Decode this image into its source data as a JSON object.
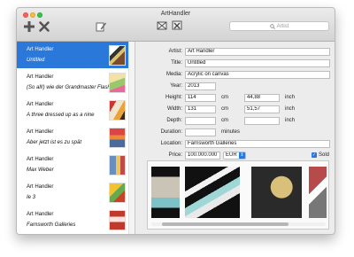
{
  "window": {
    "title": "ArtHandler"
  },
  "toolbar": {
    "search_placeholder": "Artist"
  },
  "list": [
    {
      "artist": "Art Handler",
      "title": "Untitled"
    },
    {
      "artist": "Art Handler",
      "title": "(So all!) wie der Grandmaster Flash"
    },
    {
      "artist": "Art Handler",
      "title": "A three dressed up as a nine"
    },
    {
      "artist": "Art Handler",
      "title": "Aber jetzt ist es zu spät"
    },
    {
      "artist": "Art Handler",
      "title": "Max Weber"
    },
    {
      "artist": "Art Handler",
      "title": "Ie 3"
    },
    {
      "artist": "Art Handler",
      "title": "Farnsworth Galleries"
    }
  ],
  "form": {
    "artist_label": "Artist:",
    "artist_value": "Art Handler",
    "title_label": "Title:",
    "title_value": "Untitled",
    "media_label": "Media:",
    "media_value": "Acrylic on canvas",
    "year_label": "Year:",
    "year_value": "2013",
    "height_label": "Height:",
    "height_cm": "114",
    "height_inch": "44,88",
    "width_label": "Width:",
    "width_cm": "131",
    "width_inch": "51,57",
    "depth_label": "Depth:",
    "depth_cm": "",
    "depth_inch": "",
    "unit_cm": "cm",
    "unit_inch": "inch",
    "duration_label": "Duration:",
    "duration_value": "",
    "duration_unit": "minutes",
    "location_label": "Location:",
    "location_value": "Farnsworth Galleries",
    "price_label": "Price:",
    "price_value": "100.000.000",
    "currency": "EUR",
    "sold_label": "Sold",
    "sold_checked": true
  }
}
